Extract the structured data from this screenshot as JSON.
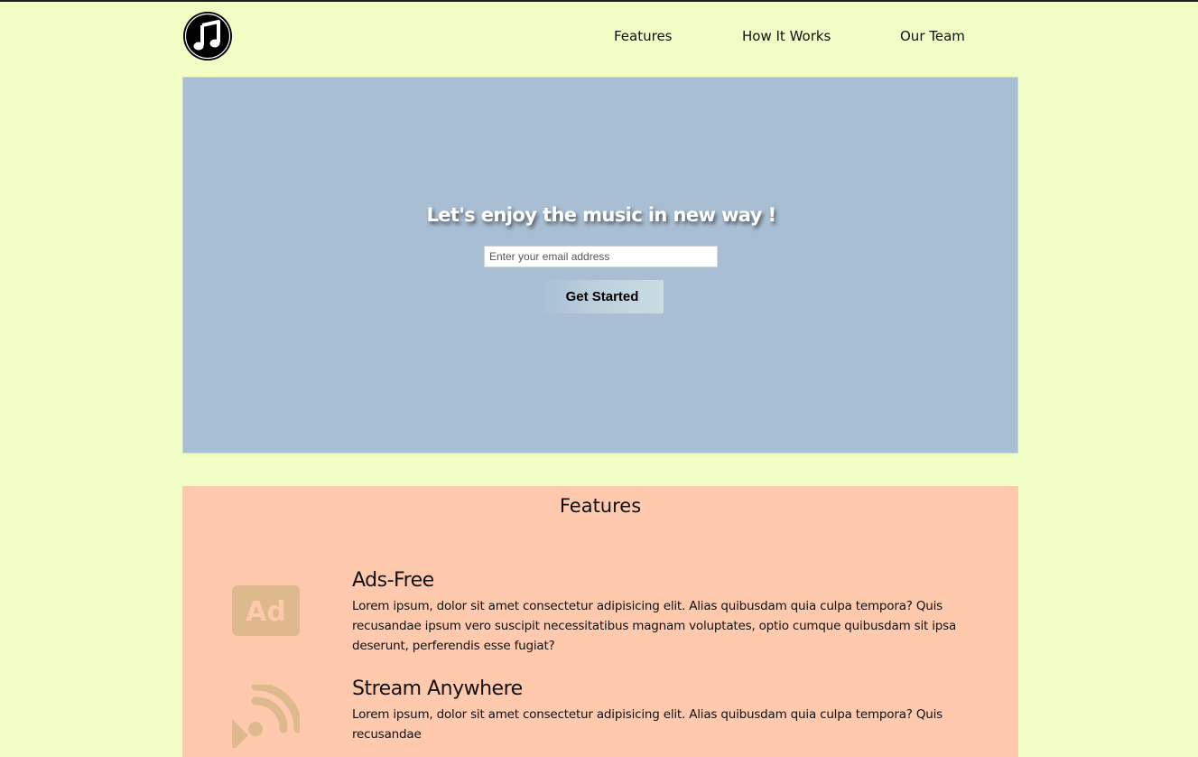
{
  "nav": {
    "logo_icon": "music-note-icon",
    "links": [
      {
        "label": "Features"
      },
      {
        "label": "How It Works"
      },
      {
        "label": "Our Team"
      }
    ]
  },
  "hero": {
    "title": "Let's enjoy the music in new way !",
    "email_placeholder": "Enter your email address",
    "email_value": "",
    "cta_label": "Get Started"
  },
  "features": {
    "title": "Features",
    "items": [
      {
        "icon": "ad-icon",
        "heading": "Ads-Free",
        "description": "Lorem ipsum, dolor sit amet consectetur adipisicing elit. Alias quibusdam quia culpa tempora? Quis recusandae ipsum vero suscipit necessitatibus magnam voluptates, optio cumque quibusdam sit ipsa deserunt, perferendis esse fugiat?"
      },
      {
        "icon": "satellite-dish-icon",
        "heading": "Stream Anywhere",
        "description": "Lorem ipsum, dolor sit amet consectetur adipisicing elit. Alias quibusdam quia culpa tempora? Quis recusandae"
      }
    ]
  },
  "colors": {
    "page_background": "#f0fdc5",
    "hero_background": "#a8bed3",
    "features_background": "#ffc9ad",
    "icon_color": "#dfb98e"
  }
}
